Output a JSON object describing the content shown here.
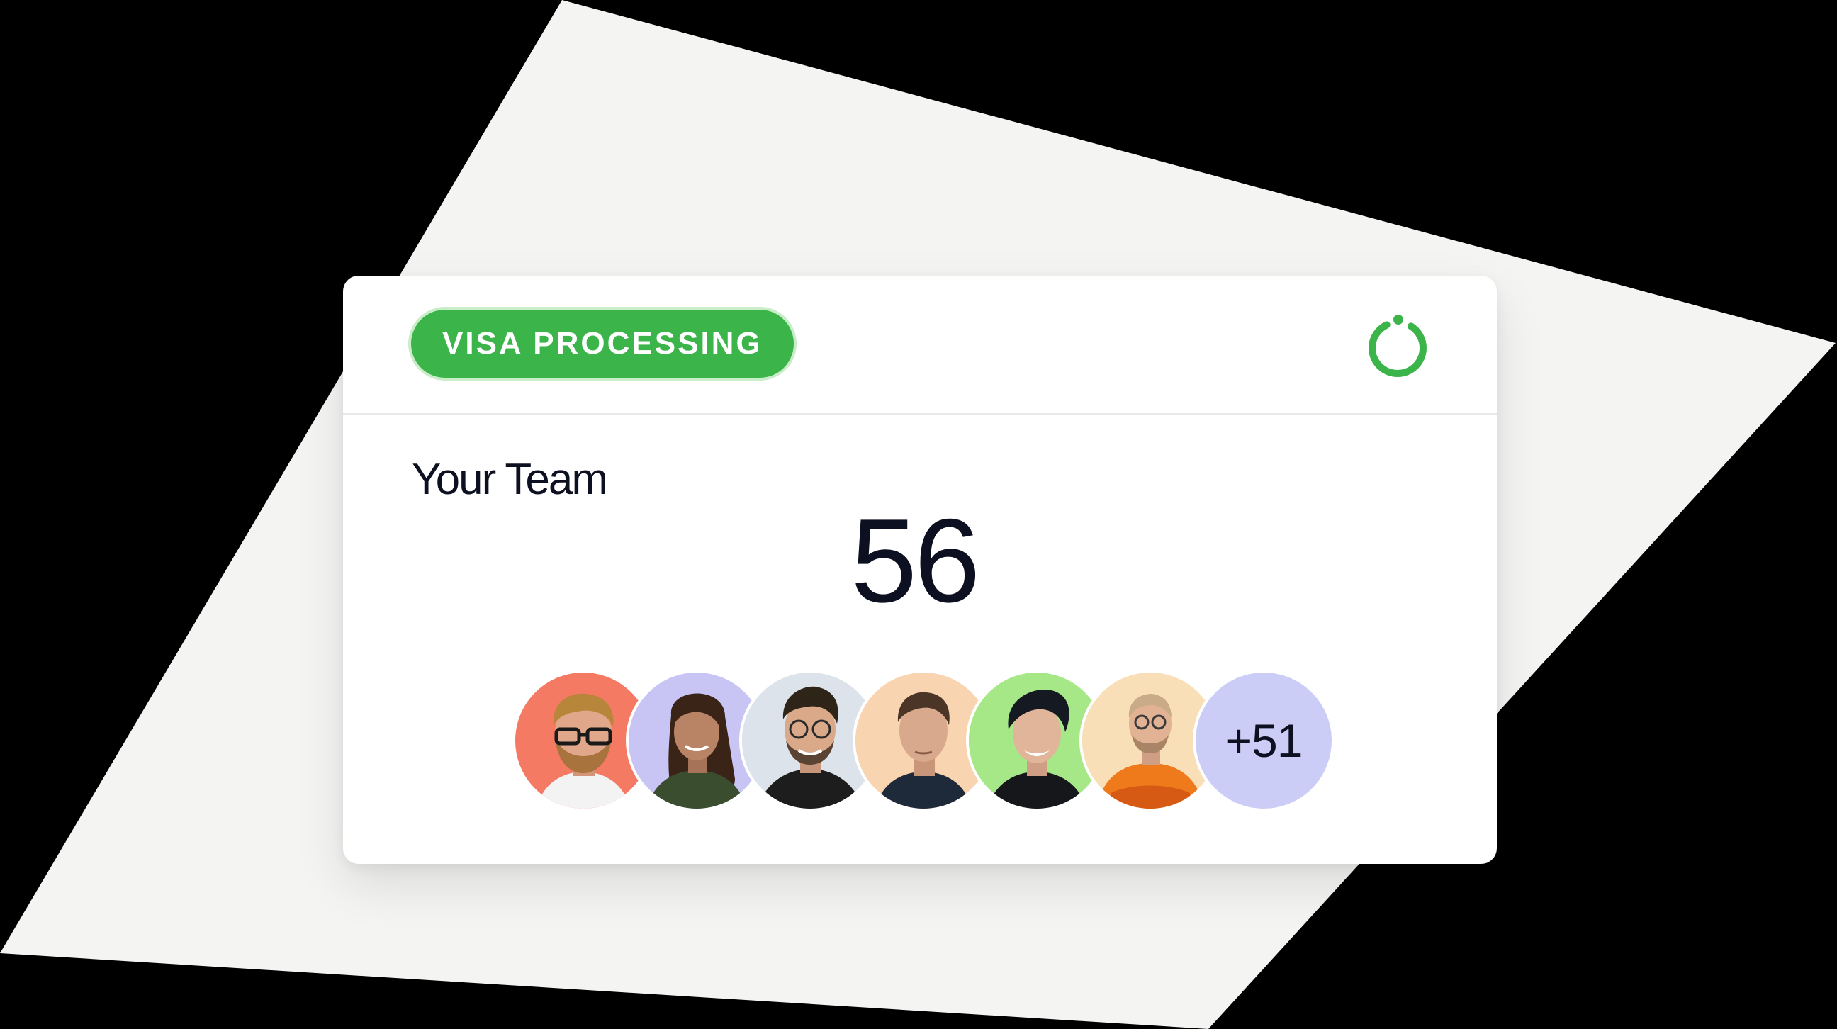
{
  "card": {
    "badge_label": "VISA PROCESSING",
    "status_icon": "loading-ring-icon",
    "section_title": "Your Team",
    "team_count": "56"
  },
  "avatars": [
    {
      "name": "avatar-person-1",
      "background": "#f47a63",
      "shirt": "#f3f3f3",
      "hair": "#b8863a",
      "skin": "#e0a78a"
    },
    {
      "name": "avatar-person-2",
      "background": "#c8c5f4",
      "shirt": "#3a4d2e",
      "hair": "#3a2418",
      "skin": "#b98466"
    },
    {
      "name": "avatar-person-3",
      "background": "#dde3ea",
      "shirt": "#1d1d1d",
      "hair": "#2e2418",
      "skin": "#d9a98a"
    },
    {
      "name": "avatar-person-4",
      "background": "#f9d4b0",
      "shirt": "#1e2a3a",
      "hair": "#4a3526",
      "skin": "#d8a98c"
    },
    {
      "name": "avatar-person-5",
      "background": "#a6e887",
      "shirt": "#15171b",
      "hair": "#151a22",
      "skin": "#e0b59a"
    },
    {
      "name": "avatar-person-6",
      "background": "#f9dfb8",
      "shirt": "#ee7a1c",
      "hair": "#c9ab8a",
      "skin": "#e2b294"
    }
  ],
  "more_count": "+51",
  "colors": {
    "page_background": "#000000",
    "backdrop_shape": "#f4f4f3",
    "card_background": "#ffffff",
    "badge_green": "#3bb54a",
    "status_green": "#3bb54a",
    "text_dark": "#0d1020",
    "more_bubble": "#cbcdf7"
  }
}
